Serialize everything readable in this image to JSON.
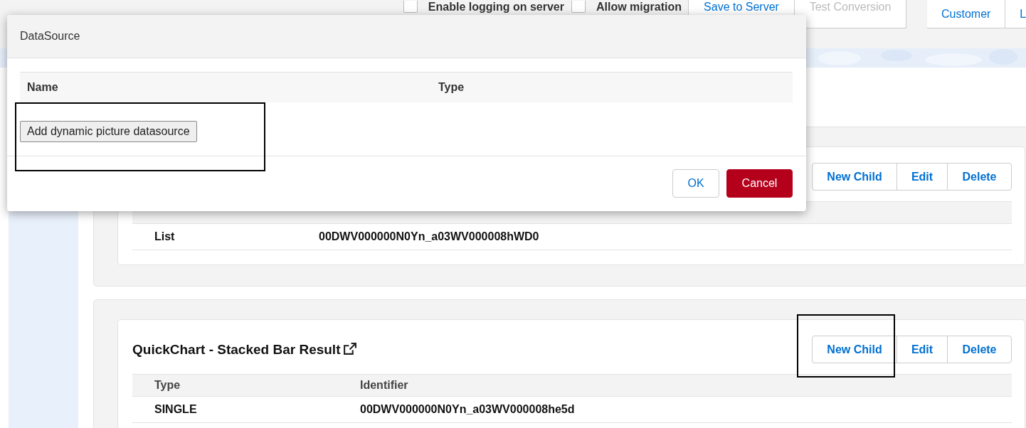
{
  "top_bar": {
    "checkboxes": [
      {
        "label": "Enable logging on server",
        "checked": false
      },
      {
        "label": "Allow migration",
        "checked": false
      }
    ],
    "buttons": [
      {
        "label": "Save to Server",
        "disabled": false
      },
      {
        "label": "Test Conversion",
        "disabled": true
      }
    ],
    "nav_tabs": [
      {
        "label": "Customer"
      },
      {
        "label": "L"
      }
    ]
  },
  "records": [
    {
      "buttons": [
        "New Child",
        "Edit",
        "Delete"
      ],
      "rows": [
        [
          "List",
          "00DWV000000N0Yn_a03WV000008hWD0"
        ]
      ]
    },
    {
      "title": "QuickChart - Stacked Bar Result",
      "buttons": [
        "New Child",
        "Edit",
        "Delete"
      ],
      "columns": [
        "Type",
        "Identifier"
      ],
      "rows": [
        [
          "SINGLE",
          "00DWV000000N0Yn_a03WV000008he5d"
        ]
      ]
    }
  ],
  "dialog": {
    "title": "DataSource",
    "columns": [
      "Name",
      "Type"
    ],
    "add_button": "Add dynamic picture datasource",
    "ok": "OK",
    "cancel": "Cancel"
  }
}
